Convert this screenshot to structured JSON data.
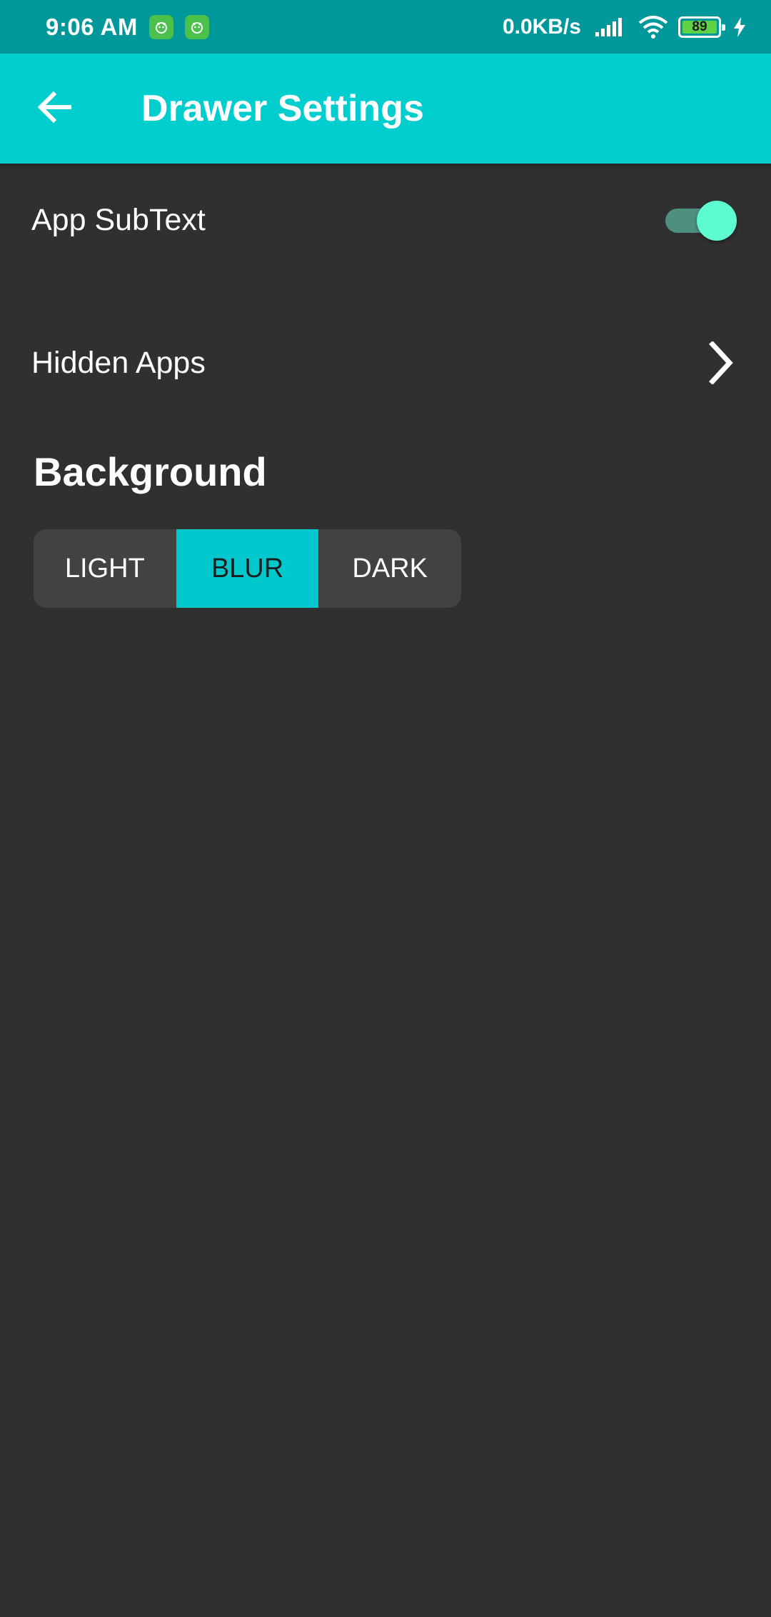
{
  "status_bar": {
    "time": "9:06 AM",
    "net_speed": "0.0KB/s",
    "battery_level": "89",
    "battery_fraction": 0.89,
    "icons": [
      "notification-app-icon",
      "notification-app-icon",
      "signal-icon",
      "wifi-icon",
      "battery-icon",
      "charging-icon"
    ]
  },
  "app_bar": {
    "title": "Drawer Settings",
    "back_icon": "arrow-back-icon"
  },
  "settings": {
    "app_subtext": {
      "label": "App SubText",
      "enabled": true
    },
    "hidden_apps": {
      "label": "Hidden Apps",
      "icon": "chevron-right-icon"
    }
  },
  "background": {
    "title": "Background",
    "options": [
      "LIGHT",
      "BLUR",
      "DARK"
    ],
    "selected": "BLUR"
  },
  "colors": {
    "accent": "#00cdcd",
    "status_bar": "#00989b",
    "background": "#303030",
    "segment_bg": "#424242",
    "toggle_thumb": "#5efad0"
  }
}
